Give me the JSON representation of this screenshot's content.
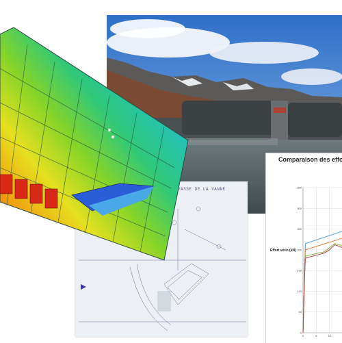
{
  "photo": {
    "sky": "#3f7fd0",
    "water": "#5a6a6e"
  },
  "drawing": {
    "title": "PASSE DE LA VANNE",
    "paper": "#eef0f4"
  },
  "chart": {
    "title": "Comparaison des efforts",
    "ylabel": "Effort vérin (kN)"
  },
  "chart_data": {
    "type": "line",
    "title": "Comparaison des efforts",
    "xlabel": "",
    "ylabel": "Effort vérin (kN)",
    "ylim": [
      0,
      350
    ],
    "xlim": [
      0,
      15
    ],
    "y_ticks": [
      0,
      50,
      100,
      150,
      200,
      250,
      300,
      350
    ],
    "x_ticks": [
      0,
      5,
      10
    ],
    "grid": true,
    "series": [
      {
        "color": "#5aa0d8",
        "x": [
          0,
          0.6,
          0.9,
          15
        ],
        "y": [
          0,
          160,
          215,
          245
        ]
      },
      {
        "color": "#e08040",
        "x": [
          0,
          0.6,
          0.9,
          15
        ],
        "y": [
          0,
          150,
          200,
          228
        ]
      },
      {
        "color": "#8ab04a",
        "x": [
          0,
          0.6,
          0.9,
          8,
          10,
          12,
          15
        ],
        "y": [
          0,
          140,
          185,
          195,
          205,
          215,
          210
        ]
      },
      {
        "color": "#b04040",
        "x": [
          0,
          0.6,
          0.9,
          8,
          10,
          12,
          15
        ],
        "y": [
          0,
          135,
          180,
          192,
          200,
          212,
          205
        ]
      }
    ]
  },
  "fem": {
    "colors": [
      "#1f3fd0",
      "#19b0e0",
      "#2fc87a",
      "#7ad22a",
      "#e8e020",
      "#f0a010",
      "#e83018"
    ]
  }
}
